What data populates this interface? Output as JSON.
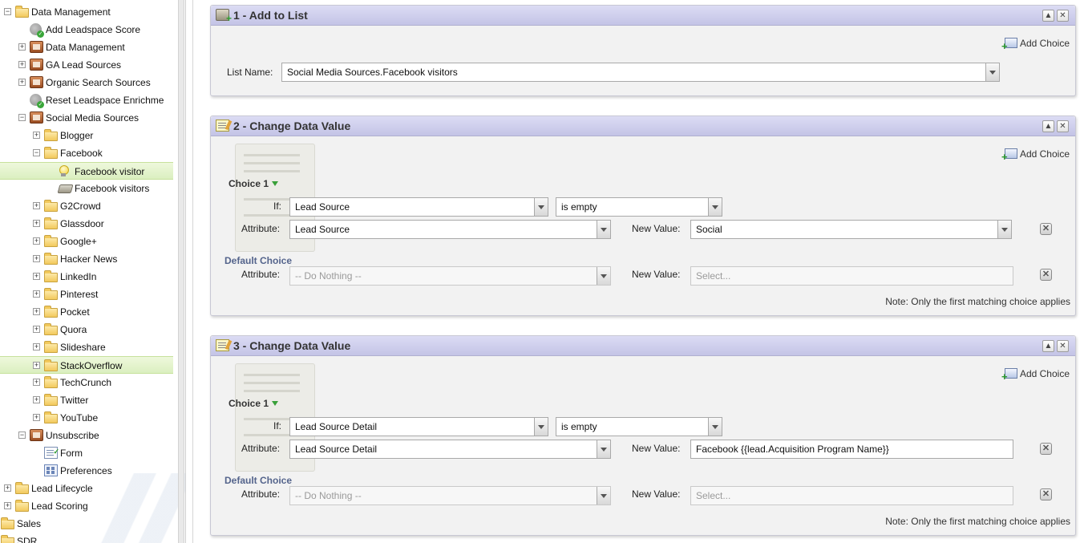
{
  "sidebar": {
    "tree": [
      {
        "label": "Data Management",
        "indent": 1,
        "icon": "folder-icon",
        "expander": "minus"
      },
      {
        "label": "Add Leadspace Score",
        "indent": 2,
        "icon": "smart-campaign-icon",
        "expander": ""
      },
      {
        "label": "Data Management",
        "indent": 2,
        "icon": "program-icon",
        "expander": "plus"
      },
      {
        "label": "GA Lead Sources",
        "indent": 2,
        "icon": "program-icon",
        "expander": "plus"
      },
      {
        "label": "Organic Search Sources",
        "indent": 2,
        "icon": "program-icon",
        "expander": "plus"
      },
      {
        "label": "Reset Leadspace Enrichme",
        "indent": 2,
        "icon": "smart-campaign-icon",
        "expander": ""
      },
      {
        "label": "Social Media Sources",
        "indent": 2,
        "icon": "program-icon",
        "expander": "minus"
      },
      {
        "label": "Blogger",
        "indent": 3,
        "icon": "folder-icon",
        "expander": "plus"
      },
      {
        "label": "Facebook",
        "indent": 3,
        "icon": "folder-icon",
        "expander": "minus"
      },
      {
        "label": "Facebook visitor",
        "indent": 4,
        "icon": "lightbulb-icon",
        "expander": "",
        "selected": true
      },
      {
        "label": "Facebook visitors",
        "indent": 4,
        "icon": "static-list-icon",
        "expander": ""
      },
      {
        "label": "G2Crowd",
        "indent": 3,
        "icon": "folder-icon",
        "expander": "plus"
      },
      {
        "label": "Glassdoor",
        "indent": 3,
        "icon": "folder-icon",
        "expander": "plus"
      },
      {
        "label": "Google+",
        "indent": 3,
        "icon": "folder-icon",
        "expander": "plus"
      },
      {
        "label": "Hacker News",
        "indent": 3,
        "icon": "folder-icon",
        "expander": "plus"
      },
      {
        "label": "LinkedIn",
        "indent": 3,
        "icon": "folder-icon",
        "expander": "plus"
      },
      {
        "label": "Pinterest",
        "indent": 3,
        "icon": "folder-icon",
        "expander": "plus"
      },
      {
        "label": "Pocket",
        "indent": 3,
        "icon": "folder-icon",
        "expander": "plus"
      },
      {
        "label": "Quora",
        "indent": 3,
        "icon": "folder-icon",
        "expander": "plus"
      },
      {
        "label": "Slideshare",
        "indent": 3,
        "icon": "folder-icon",
        "expander": "plus"
      },
      {
        "label": "StackOverflow",
        "indent": 3,
        "icon": "folder-icon",
        "expander": "plus",
        "selected": true
      },
      {
        "label": "TechCrunch",
        "indent": 3,
        "icon": "folder-icon",
        "expander": "plus"
      },
      {
        "label": "Twitter",
        "indent": 3,
        "icon": "folder-icon",
        "expander": "plus"
      },
      {
        "label": "YouTube",
        "indent": 3,
        "icon": "folder-icon",
        "expander": "plus"
      },
      {
        "label": "Unsubscribe",
        "indent": 2,
        "icon": "program-icon",
        "expander": "minus"
      },
      {
        "label": "Form",
        "indent": 3,
        "icon": "form-icon",
        "expander": ""
      },
      {
        "label": "Preferences",
        "indent": 3,
        "icon": "landing-page-icon",
        "expander": ""
      },
      {
        "label": "Lead Lifecycle",
        "indent": 1,
        "icon": "folder-icon",
        "expander": "plus"
      },
      {
        "label": "Lead Scoring",
        "indent": 1,
        "icon": "folder-icon",
        "expander": "plus"
      },
      {
        "label": "Sales",
        "indent": 0,
        "icon": "folder-icon",
        "expander": "plus"
      },
      {
        "label": "SDR",
        "indent": 0,
        "icon": "folder-icon",
        "expander": "plus"
      }
    ]
  },
  "flow": {
    "step1": {
      "title": "1 - Add to List",
      "add_choice": "Add Choice",
      "list_name_label": "List Name:",
      "list_name_value": "Social Media Sources.Facebook visitors"
    },
    "step2": {
      "title": "2 - Change Data Value",
      "add_choice": "Add Choice",
      "choice_label": "Choice 1",
      "if_label": "If:",
      "if_attribute": "Lead Source",
      "if_operator": "is empty",
      "attribute_label": "Attribute:",
      "attribute_value": "Lead Source",
      "new_value_label": "New Value:",
      "new_value": "Social",
      "default_label": "Default Choice",
      "default_attribute_label": "Attribute:",
      "default_attribute_value": "-- Do Nothing --",
      "default_new_value_label": "New Value:",
      "default_new_value_placeholder": "Select...",
      "note": "Note: Only the first matching choice applies"
    },
    "step3": {
      "title": "3 - Change Data Value",
      "add_choice": "Add Choice",
      "choice_label": "Choice 1",
      "if_label": "If:",
      "if_attribute": "Lead Source Detail",
      "if_operator": "is empty",
      "attribute_label": "Attribute:",
      "attribute_value": "Lead Source Detail",
      "new_value_label": "New Value:",
      "new_value": "Facebook {{lead.Acquisition Program Name}}",
      "default_label": "Default Choice",
      "default_attribute_label": "Attribute:",
      "default_attribute_value": "-- Do Nothing --",
      "default_new_value_label": "New Value:",
      "default_new_value_placeholder": "Select...",
      "note": "Note: Only the first matching choice applies"
    }
  }
}
